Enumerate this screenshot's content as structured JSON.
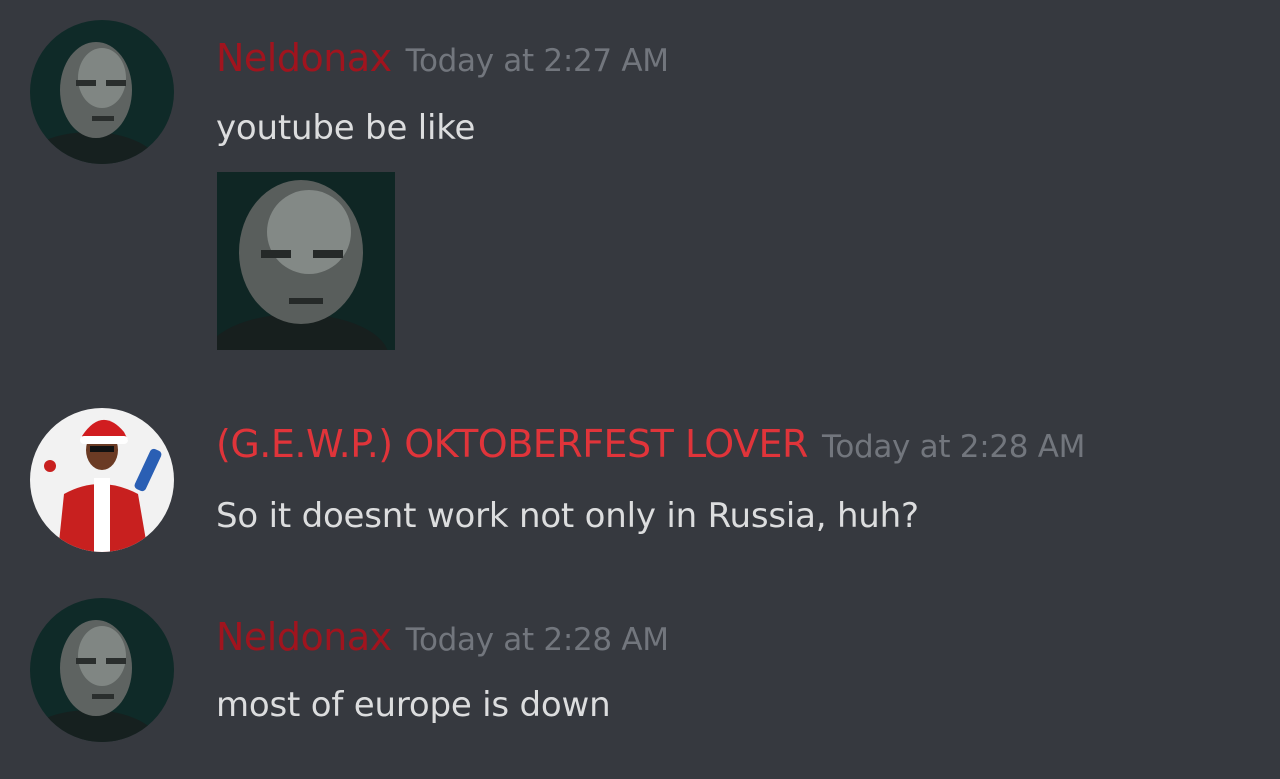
{
  "colors": {
    "background": "#36393f",
    "text": "#dcddde",
    "timestamp": "#72767d",
    "username_dark_red": "#a0141e",
    "username_red": "#e0343a"
  },
  "messages": [
    {
      "author": "Neldonax",
      "author_color": "#a0141e",
      "timestamp": "Today at 2:27 AM",
      "text": "youtube be like",
      "avatar_icon": "bald-man-portrait",
      "attachment_icon": "bald-man-portrait-image"
    },
    {
      "author": "(G.E.W.P.) OKTOBERFEST LOVER",
      "author_color": "#e0343a",
      "timestamp": "Today at 2:28 AM",
      "text": "So it doesnt work not only in Russia, huh?",
      "avatar_icon": "santa-costume-man-portrait"
    },
    {
      "author": "Neldonax",
      "author_color": "#a0141e",
      "timestamp": "Today at 2:28 AM",
      "text": "most of europe is down",
      "avatar_icon": "bald-man-portrait"
    }
  ]
}
